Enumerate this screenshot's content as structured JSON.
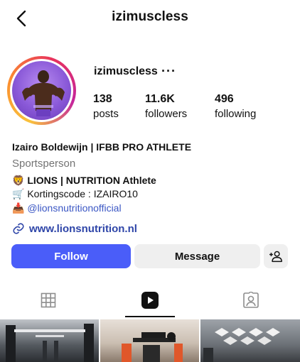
{
  "header": {
    "title": "izimuscless"
  },
  "profile": {
    "username": "izimuscless",
    "stats": [
      {
        "value": "138",
        "label": "posts"
      },
      {
        "value": "11.6K",
        "label": "followers"
      },
      {
        "value": "496",
        "label": "following"
      }
    ],
    "full_name": "Izairo Boldewijn | IFBB PRO ATHLETE",
    "category": "Sportsperson",
    "bio": [
      {
        "emoji": "🦁",
        "text": "LIONS | NUTRITION Athlete"
      },
      {
        "emoji": "🛒",
        "text": "Kortingscode : IZAIRO10"
      },
      {
        "emoji": "📥",
        "text": "@lionsnutritionofficial"
      }
    ],
    "link": "www.lionsnutrition.nl"
  },
  "actions": {
    "follow_label": "Follow",
    "message_label": "Message"
  },
  "tabs": [
    {
      "icon": "grid-icon",
      "active": false
    },
    {
      "icon": "reels-icon",
      "active": true
    },
    {
      "icon": "tagged-icon",
      "active": false
    }
  ],
  "colors": {
    "follow_button": "#4a5df9",
    "link": "#2e45a8",
    "secondary_button": "#efefef"
  }
}
